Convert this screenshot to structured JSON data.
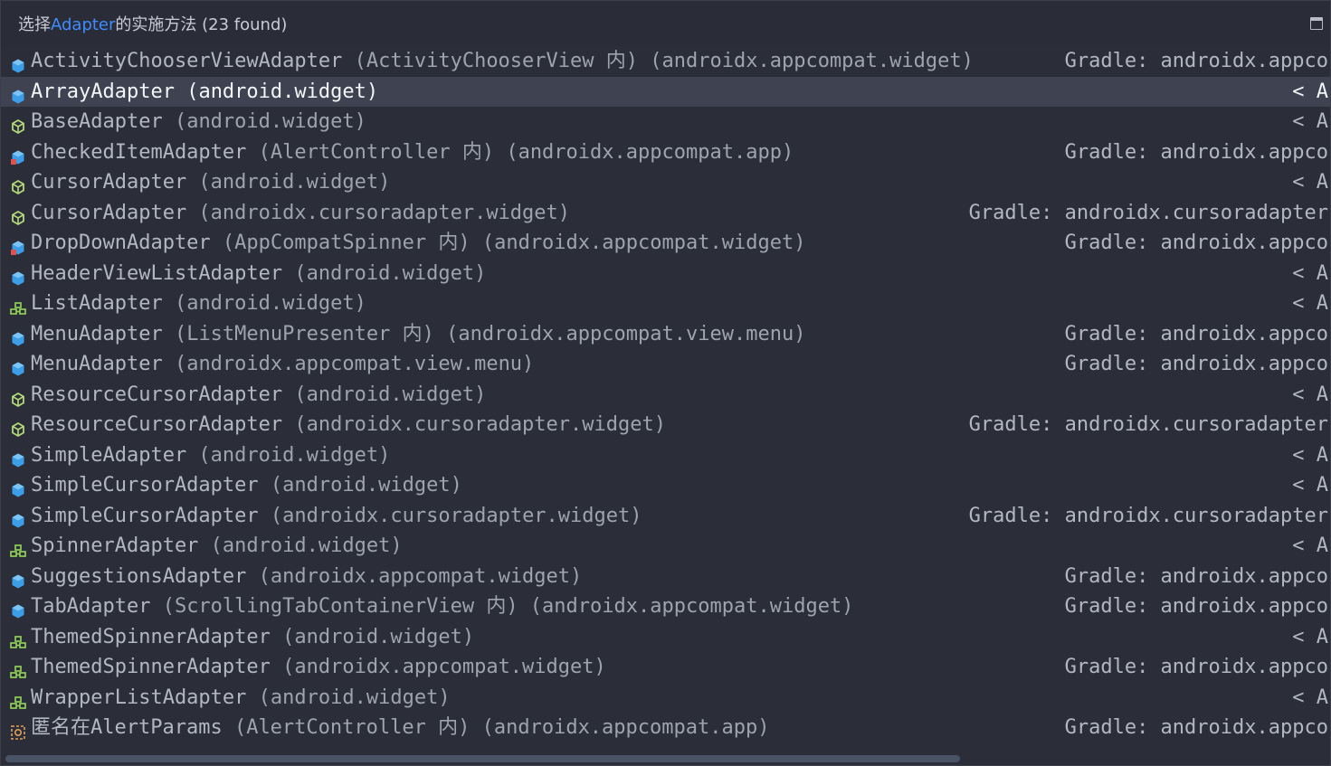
{
  "header": {
    "title_prefix": "选择",
    "title_highlight": "Adapter",
    "title_suffix": "的实施方法 (23 found)"
  },
  "items": [
    {
      "icon": "class",
      "name": "ActivityChooserViewAdapter",
      "location": " (ActivityChooserView 内) (androidx.appcompat.widget)",
      "right": "Gradle: androidx.appco"
    },
    {
      "icon": "class",
      "name": "ArrayAdapter",
      "location": " (android.widget)",
      "right": "< A",
      "selected": true
    },
    {
      "icon": "abstract",
      "name": "BaseAdapter",
      "location": " (android.widget)",
      "right": "< A"
    },
    {
      "icon": "class-locked",
      "name": "CheckedItemAdapter",
      "location": " (AlertController 内) (androidx.appcompat.app)",
      "right": "Gradle: androidx.appco"
    },
    {
      "icon": "abstract",
      "name": "CursorAdapter",
      "location": " (android.widget)",
      "right": "< A"
    },
    {
      "icon": "abstract",
      "name": "CursorAdapter",
      "location": " (androidx.cursoradapter.widget)",
      "right": "Gradle: androidx.cursoradapter"
    },
    {
      "icon": "class-locked",
      "name": "DropDownAdapter",
      "location": " (AppCompatSpinner 内) (androidx.appcompat.widget)",
      "right": "Gradle: androidx.appco"
    },
    {
      "icon": "class",
      "name": "HeaderViewListAdapter",
      "location": " (android.widget)",
      "right": "< A"
    },
    {
      "icon": "interface",
      "name": "ListAdapter",
      "location": " (android.widget)",
      "right": "< A"
    },
    {
      "icon": "class",
      "name": "MenuAdapter",
      "location": " (ListMenuPresenter 内) (androidx.appcompat.view.menu)",
      "right": "Gradle: androidx.appco"
    },
    {
      "icon": "class",
      "name": "MenuAdapter",
      "location": " (androidx.appcompat.view.menu)",
      "right": "Gradle: androidx.appco"
    },
    {
      "icon": "abstract",
      "name": "ResourceCursorAdapter",
      "location": " (android.widget)",
      "right": "< A"
    },
    {
      "icon": "abstract",
      "name": "ResourceCursorAdapter",
      "location": " (androidx.cursoradapter.widget)",
      "right": "Gradle: androidx.cursoradapter"
    },
    {
      "icon": "class",
      "name": "SimpleAdapter",
      "location": " (android.widget)",
      "right": "< A"
    },
    {
      "icon": "class",
      "name": "SimpleCursorAdapter",
      "location": " (android.widget)",
      "right": "< A"
    },
    {
      "icon": "class",
      "name": "SimpleCursorAdapter",
      "location": " (androidx.cursoradapter.widget)",
      "right": "Gradle: androidx.cursoradapter"
    },
    {
      "icon": "interface",
      "name": "SpinnerAdapter",
      "location": " (android.widget)",
      "right": "< A"
    },
    {
      "icon": "class",
      "name": "SuggestionsAdapter",
      "location": " (androidx.appcompat.widget)",
      "right": "Gradle: androidx.appco"
    },
    {
      "icon": "class",
      "name": "TabAdapter",
      "location": " (ScrollingTabContainerView 内) (androidx.appcompat.widget)",
      "right": "Gradle: androidx.appco"
    },
    {
      "icon": "interface",
      "name": "ThemedSpinnerAdapter",
      "location": " (android.widget)",
      "right": "< A"
    },
    {
      "icon": "interface",
      "name": "ThemedSpinnerAdapter",
      "location": " (androidx.appcompat.widget)",
      "right": "Gradle: androidx.appco"
    },
    {
      "icon": "interface",
      "name": "WrapperListAdapter",
      "location": " (android.widget)",
      "right": "< A"
    },
    {
      "icon": "anonymous",
      "name": "匿名在AlertParams",
      "location": " (AlertController 内) (androidx.appcompat.app)",
      "right": "Gradle: androidx.appco"
    }
  ],
  "colors": {
    "class_icon": "#3d9ee8",
    "abstract_icon": "#b4d97a",
    "interface_icon": "#8fcf5a",
    "anonymous_icon": "#e0a25a",
    "accent": "#3f8cff",
    "selection": "#3e4251",
    "background": "#2b2d38"
  }
}
